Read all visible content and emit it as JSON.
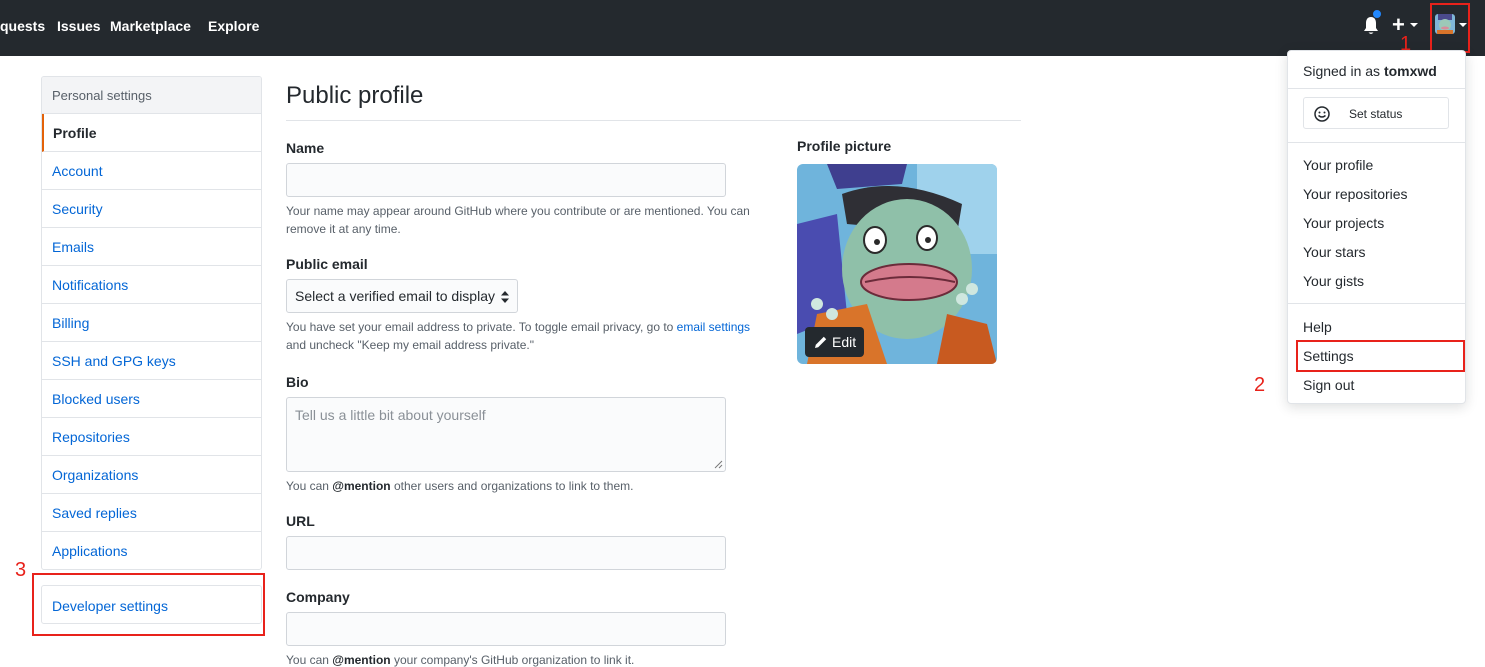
{
  "header": {
    "nav": [
      "quests",
      "Issues",
      "Marketplace",
      "Explore"
    ]
  },
  "annotations": {
    "step1": "1",
    "step2": "2",
    "step3": "3",
    "color": "#e8221b"
  },
  "sidebar": {
    "heading": "Personal settings",
    "items": [
      {
        "label": "Profile",
        "active": true
      },
      {
        "label": "Account"
      },
      {
        "label": "Security"
      },
      {
        "label": "Emails"
      },
      {
        "label": "Notifications"
      },
      {
        "label": "Billing"
      },
      {
        "label": "SSH and GPG keys"
      },
      {
        "label": "Blocked users"
      },
      {
        "label": "Repositories"
      },
      {
        "label": "Organizations"
      },
      {
        "label": "Saved replies"
      },
      {
        "label": "Applications"
      }
    ],
    "developer_settings": "Developer settings"
  },
  "main": {
    "title": "Public profile",
    "name": {
      "label": "Name",
      "value": "",
      "note": "Your name may appear around GitHub where you contribute or are mentioned. You can remove it at any time."
    },
    "public_email": {
      "label": "Public email",
      "selected": "Select a verified email to display",
      "note_before": "You have set your email address to private. To toggle email privacy, go to ",
      "note_link": "email settings",
      "note_after": " and uncheck \"Keep my email address private.\""
    },
    "bio": {
      "label": "Bio",
      "placeholder": "Tell us a little bit about yourself",
      "note_before": "You can ",
      "note_mention": "@mention",
      "note_after": " other users and organizations to link to them."
    },
    "url": {
      "label": "URL",
      "value": ""
    },
    "company": {
      "label": "Company",
      "value": "",
      "note_before": "You can ",
      "note_mention": "@mention",
      "note_after": " your company's GitHub organization to link it."
    },
    "profile_picture": {
      "label": "Profile picture",
      "edit": "Edit"
    }
  },
  "dropdown": {
    "signed_in_prefix": "Signed in as ",
    "username": "tomxwd",
    "set_status": "Set status",
    "group1": [
      "Your profile",
      "Your repositories",
      "Your projects",
      "Your stars",
      "Your gists"
    ],
    "group2": [
      "Help",
      "Settings",
      "Sign out"
    ]
  },
  "colors": {
    "header_bg": "#24292e",
    "link": "#0366d6",
    "active_marker": "#e36209",
    "notification_dot": "#2188ff"
  }
}
